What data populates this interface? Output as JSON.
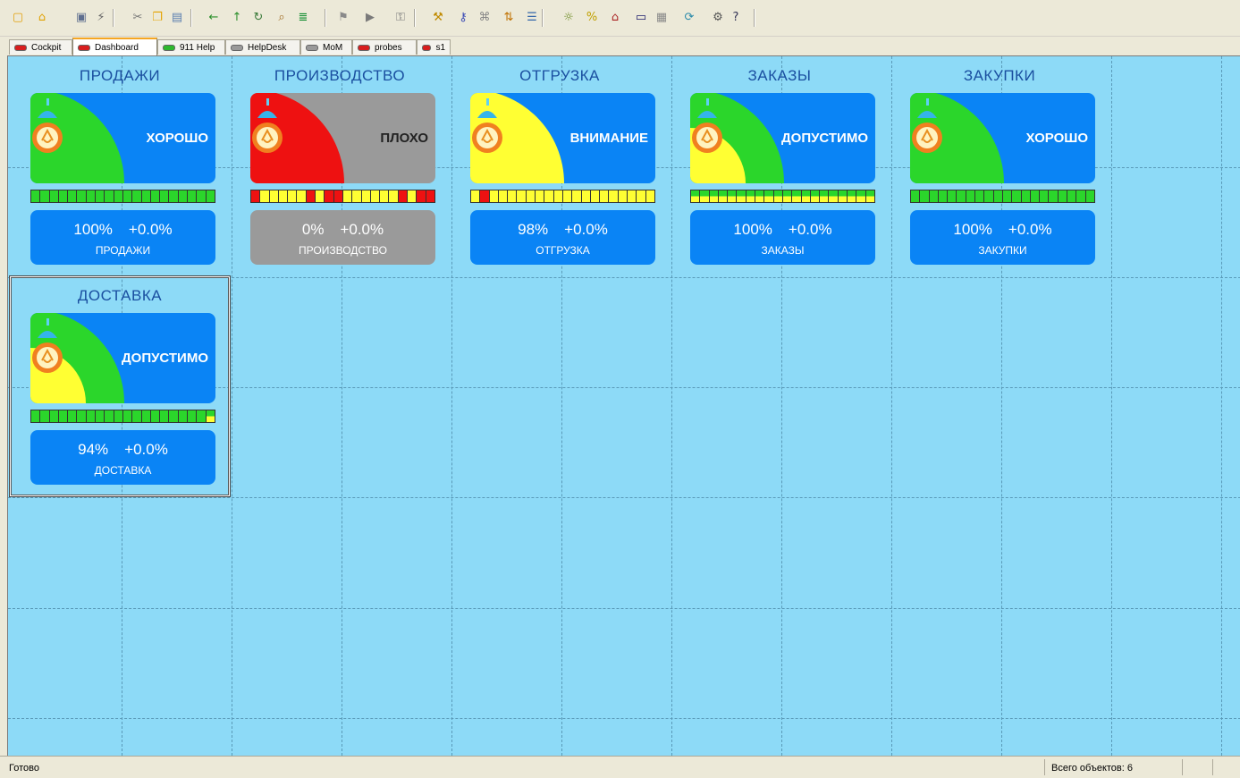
{
  "toolbar": {
    "icons": [
      "new-icon",
      "open-icon",
      "save-icon",
      "wand-icon",
      "cut-icon",
      "copy-icon",
      "paste-icon",
      "back-icon",
      "up-icon",
      "refresh-icon",
      "find-icon",
      "properties-icon",
      "filter-icon",
      "run-icon",
      "lock-icon",
      "tools-icon",
      "key-icon",
      "tag-icon",
      "sort-icon",
      "list-icon",
      "bulb-icon",
      "percent-icon",
      "home-icon",
      "monitor-icon",
      "layout-icon",
      "sync-icon",
      "settings-icon",
      "help-icon"
    ]
  },
  "tabs": [
    {
      "label": "Cockpit",
      "color": "#d81e1e",
      "active": false
    },
    {
      "label": "Dashboard",
      "color": "#d81e1e",
      "active": true
    },
    {
      "label": "911 Help",
      "color": "#2eb82e",
      "active": false
    },
    {
      "label": "HelpDesk",
      "color": "#9a9a9a",
      "active": false
    },
    {
      "label": "MoM",
      "color": "#9a9a9a",
      "active": false
    },
    {
      "label": "probes",
      "color": "#d81e1e",
      "active": false
    },
    {
      "label": "s1",
      "color": "#d81e1e",
      "active": false
    }
  ],
  "colors": {
    "canvas": "#8ddaf7",
    "panel_blue": "#0a84f5",
    "panel_gray": "#9a9a9a",
    "good": "#2bd62b",
    "warn": "#ffff33",
    "bad": "#ee1111"
  },
  "widgets": [
    {
      "title": "ПРОДАЖИ",
      "status": "ХОРОШО",
      "state": "good",
      "value": "100%",
      "change": "+0.0%",
      "name": "ПРОДАЖИ",
      "bar_segments": [
        "g",
        "g",
        "g",
        "g",
        "g",
        "g",
        "g",
        "g",
        "g",
        "g",
        "g",
        "g",
        "g",
        "g",
        "g",
        "g",
        "g",
        "g",
        "g",
        "g"
      ]
    },
    {
      "title": "ПРОИЗВОДСТВО",
      "status": "ПЛОХО",
      "state": "bad",
      "value": "0%",
      "change": "+0.0%",
      "name": "ПРОИЗВОДСТВО",
      "bar_segments": [
        "r",
        "y",
        "y",
        "y",
        "y",
        "y",
        "r",
        "y",
        "r",
        "r",
        "y",
        "y",
        "y",
        "y",
        "y",
        "y",
        "r",
        "y",
        "r",
        "r"
      ]
    },
    {
      "title": "ОТГРУЗКА",
      "status": "ВНИМАНИЕ",
      "state": "warn",
      "value": "98%",
      "change": "+0.0%",
      "name": "ОТГРУЗКА",
      "bar_segments": [
        "y",
        "r",
        "y",
        "y",
        "y",
        "y",
        "y",
        "y",
        "y",
        "y",
        "y",
        "y",
        "y",
        "y",
        "y",
        "y",
        "y",
        "y",
        "y",
        "y"
      ]
    },
    {
      "title": "ЗАКАЗЫ",
      "status": "ДОПУСТИМО",
      "state": "ok",
      "value": "100%",
      "change": "+0.0%",
      "name": "ЗАКАЗЫ",
      "bar_segments": [
        "gy",
        "gy",
        "gy",
        "gy",
        "gy",
        "gy",
        "gy",
        "gy",
        "gy",
        "gy",
        "gy",
        "gy",
        "gy",
        "gy",
        "gy",
        "gy",
        "gy",
        "gy",
        "gy",
        "gy"
      ]
    },
    {
      "title": "ЗАКУПКИ",
      "status": "ХОРОШО",
      "state": "good",
      "value": "100%",
      "change": "+0.0%",
      "name": "ЗАКУПКИ",
      "bar_segments": [
        "g",
        "g",
        "g",
        "g",
        "g",
        "g",
        "g",
        "g",
        "g",
        "g",
        "g",
        "g",
        "g",
        "g",
        "g",
        "g",
        "g",
        "g",
        "g",
        "g"
      ]
    },
    {
      "title": "ДОСТАВКА",
      "status": "ДОПУСТИМО",
      "state": "ok",
      "value": "94%",
      "change": "+0.0%",
      "name": "ДОСТАВКА",
      "bar_segments": [
        "g",
        "g",
        "g",
        "g",
        "g",
        "g",
        "g",
        "g",
        "g",
        "g",
        "g",
        "g",
        "g",
        "g",
        "g",
        "g",
        "g",
        "g",
        "g",
        "gy"
      ]
    }
  ],
  "statusbar": {
    "left": "Готово",
    "count": "Всего объектов: 6"
  }
}
